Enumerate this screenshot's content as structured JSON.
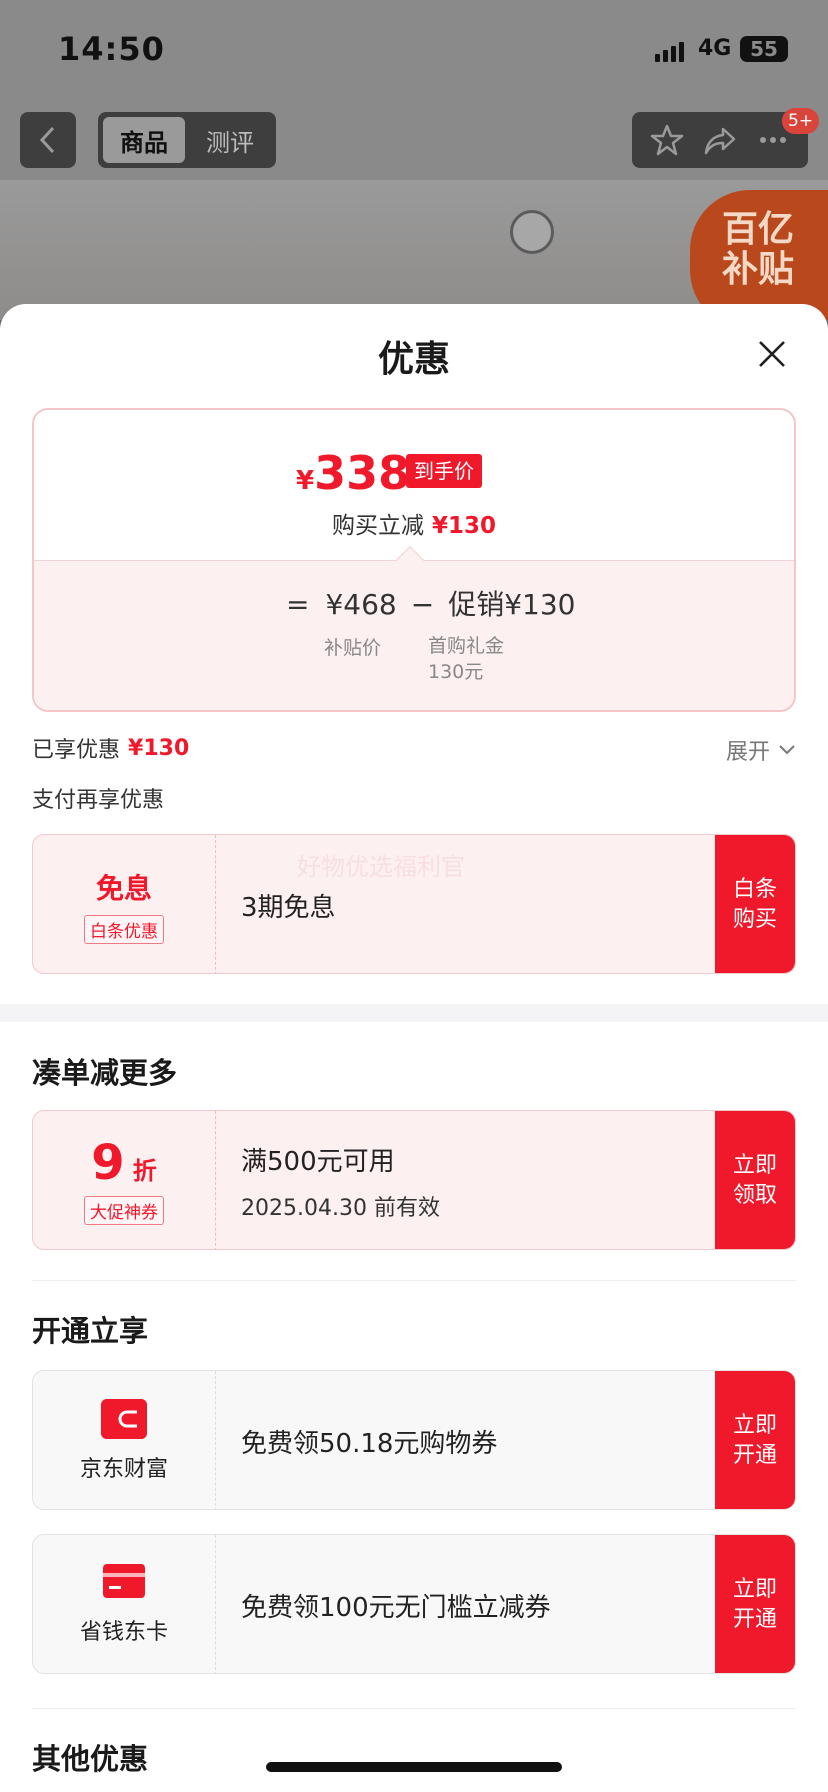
{
  "status_bar": {
    "time": "14:50",
    "network": "4G",
    "battery": "55"
  },
  "nav": {
    "tabs": [
      "商品",
      "测评"
    ],
    "badge": "5+"
  },
  "background": {
    "subsidy_badge_line1": "百亿",
    "subsidy_badge_line2": "补贴"
  },
  "sheet": {
    "title": "优惠",
    "price_card": {
      "currency": "¥",
      "final_price": "338",
      "final_tag": "到手价",
      "reduce_label": "购买立减",
      "reduce_value": "¥130",
      "eq": "=",
      "subsidy_price": "¥468",
      "minus": "−",
      "promo_label": "促销",
      "promo_value": "¥130",
      "subsidy_label": "补贴价",
      "promo_detail_line1": "首购礼金",
      "promo_detail_line2": "130元"
    },
    "enjoyed": {
      "label": "已享优惠",
      "value": "¥130",
      "expand": "展开"
    },
    "pay_section_title": "支付再享优惠",
    "baitiao_coupon": {
      "title": "免息",
      "tag": "白条优惠",
      "watermark": "好物优选福利官",
      "desc": "3期免息",
      "button": "白条购买"
    },
    "more_section_title": "凑单减更多",
    "discount_coupon": {
      "value": "9",
      "unit": "折",
      "tag": "大促神券",
      "desc": "满500元可用",
      "expiry": "2025.04.30 前有效",
      "button": "立即领取"
    },
    "open_section_title": "开通立享",
    "open_items": [
      {
        "icon": "wallet-icon",
        "name": "京东财富",
        "desc": "免费领50.18元购物券",
        "button": "立即开通"
      },
      {
        "icon": "card-icon",
        "name": "省钱东卡",
        "desc": "免费领100元无门槛立减券",
        "button": "立即开通"
      }
    ],
    "other_section_title": "其他优惠"
  },
  "colors": {
    "accent_red": "#f0192c",
    "light_pink": "#fdf0f1"
  }
}
